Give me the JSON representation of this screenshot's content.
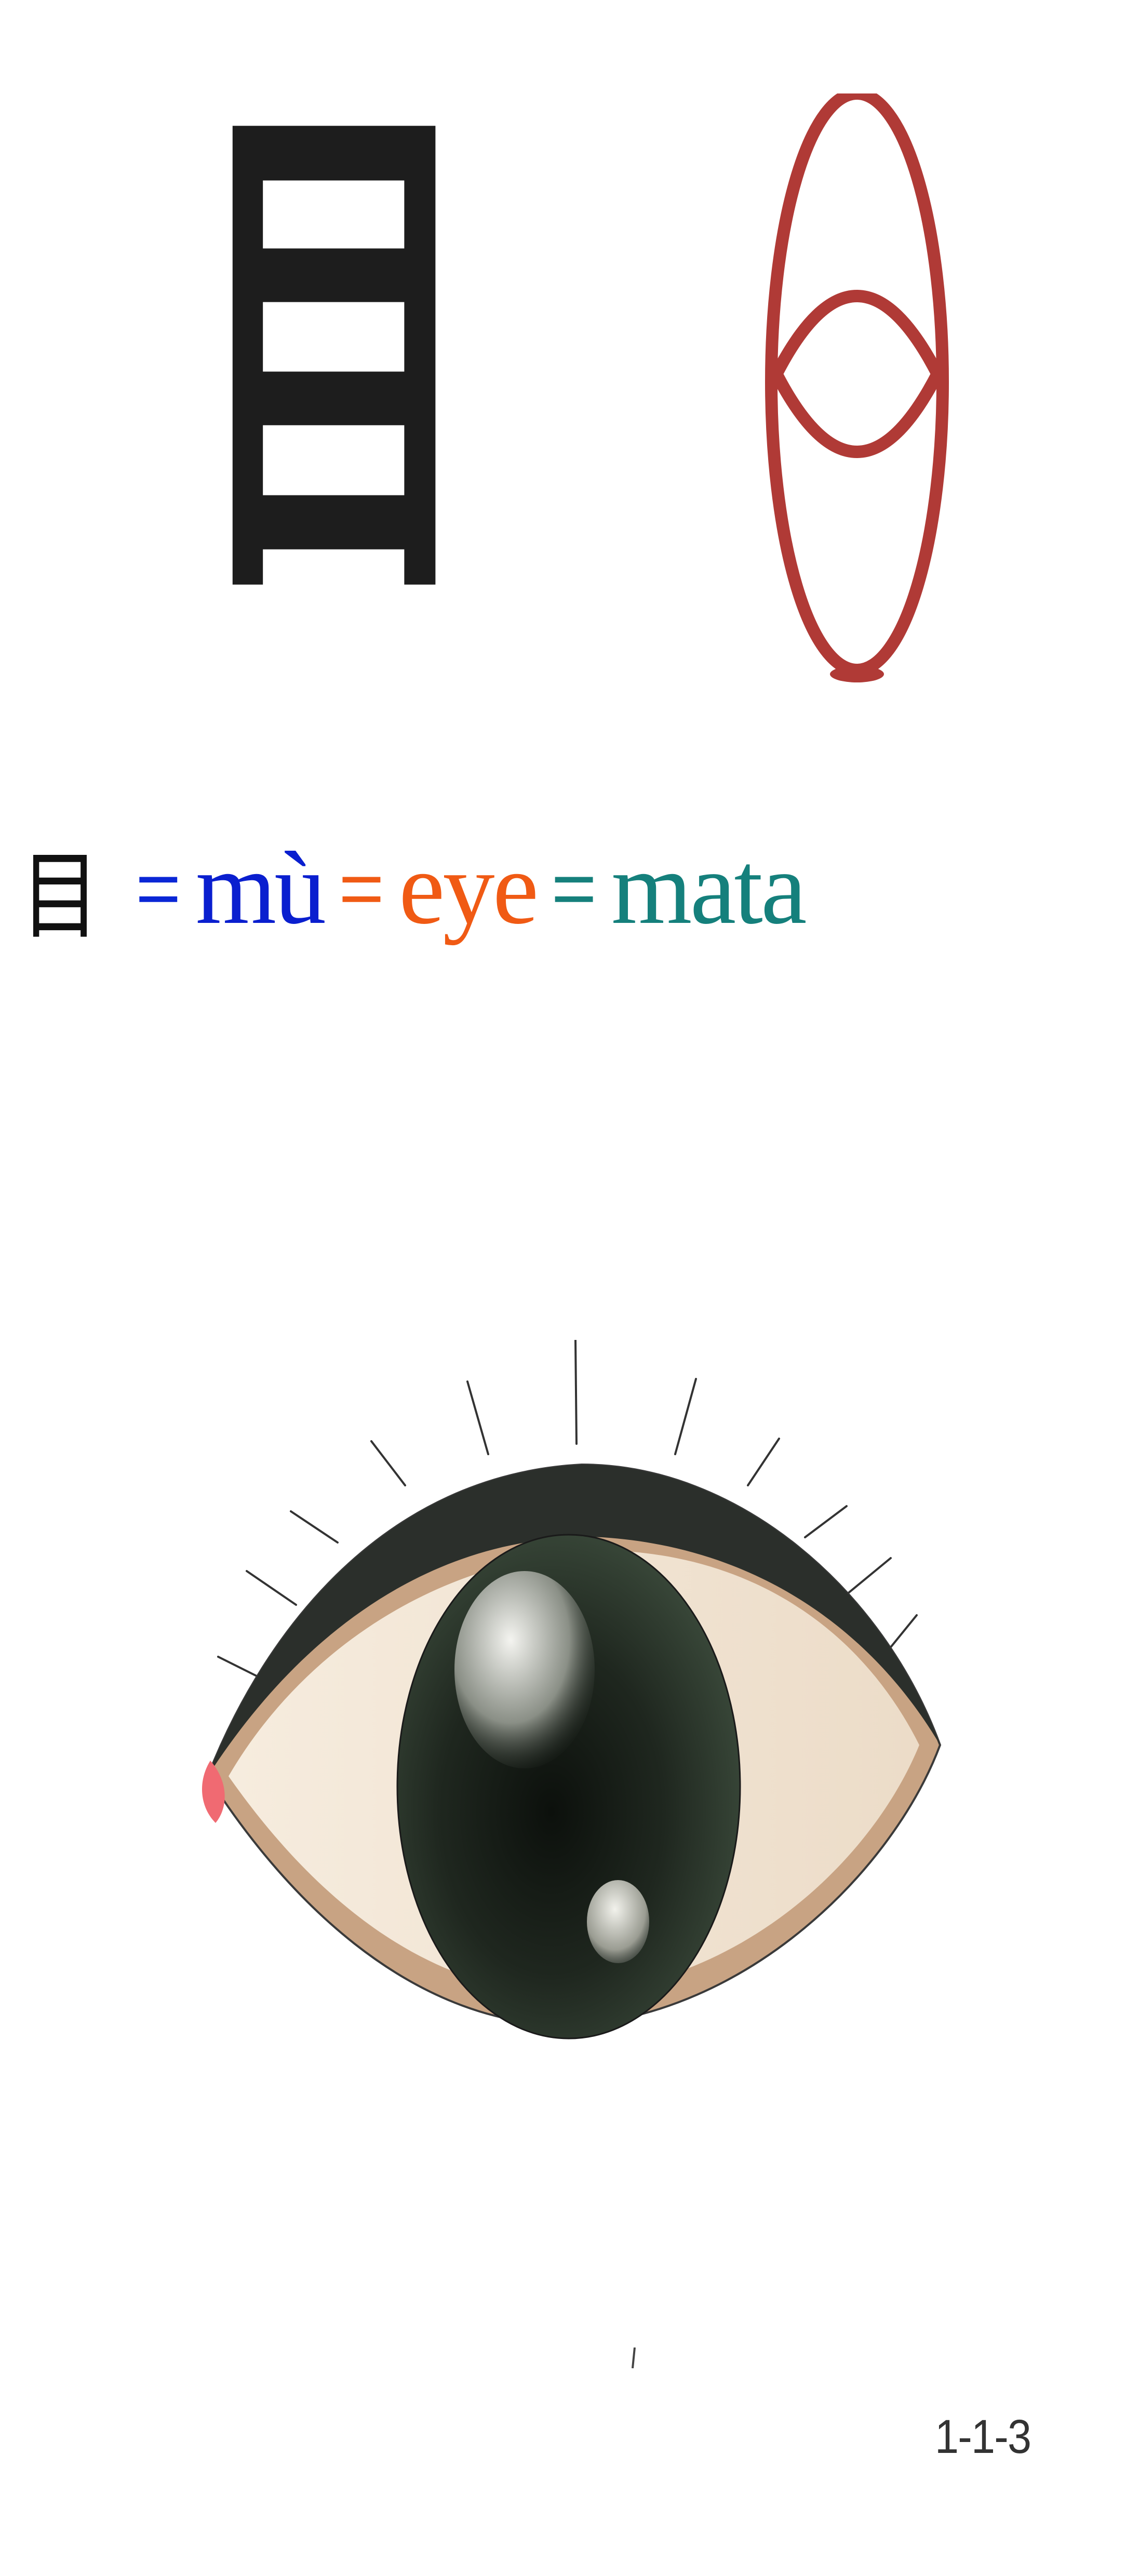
{
  "colors": {
    "character": "#1d1d1d",
    "pictograph": "#b03a36",
    "equals": "#0a26d6",
    "pinyin": "#0a1fcf",
    "english": "#f05a14",
    "malay": "#15807c",
    "lid": "#2b2f2b",
    "sclera": "#f2e6d6",
    "skin": "#c8a383",
    "iris": "#1c231c"
  },
  "main_character": "目",
  "equation": {
    "character": "目",
    "pinyin": "mù",
    "english": "eye",
    "malay": "mata",
    "equals": "="
  },
  "page_number": "1-1-3"
}
